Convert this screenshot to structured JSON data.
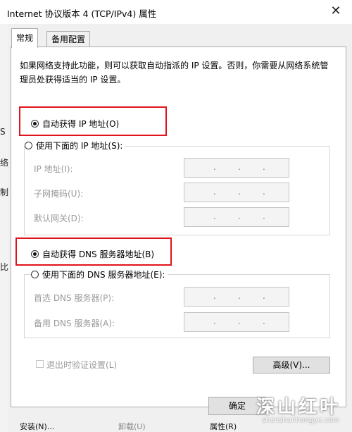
{
  "window": {
    "title": "Internet 协议版本 4 (TCP/IPv4) 属性",
    "close_glyph": "✕"
  },
  "tabs": [
    {
      "label": "常规",
      "active": true
    },
    {
      "label": "备用配置",
      "active": false
    }
  ],
  "description": "如果网络支持此功能，则可以获取自动指派的 IP 设置。否则，你需要从网络系统管理员处获得适当的 IP 设置。",
  "ip_section": {
    "auto_label": "自动获得 IP 地址(O)",
    "manual_label": "使用下面的 IP 地址(S):",
    "auto_selected": true,
    "fields": [
      {
        "label": "IP 地址(I):",
        "value": ". . ."
      },
      {
        "label": "子网掩码(U):",
        "value": ". . ."
      },
      {
        "label": "默认网关(D):",
        "value": ". . ."
      }
    ]
  },
  "dns_section": {
    "auto_label": "自动获得 DNS 服务器地址(B)",
    "manual_label": "使用下面的 DNS 服务器地址(E):",
    "auto_selected": true,
    "fields": [
      {
        "label": "首选 DNS 服务器(P):",
        "value": ". . ."
      },
      {
        "label": "备用 DNS 服务器(A):",
        "value": ". . ."
      }
    ]
  },
  "validate_on_exit_label": "退出时验证设置(L)",
  "advanced_button_label": "高级(V)...",
  "ok_button_label": "确定",
  "background_window": {
    "left_glyphs": [
      "络",
      "制",
      "比",
      "S"
    ],
    "bottom_buttons": [
      "安装(N)...",
      "卸载(U)",
      "属性(R)"
    ]
  },
  "watermark": {
    "main": "深山红叶",
    "sub": "shenshanhongye.com"
  },
  "colors": {
    "highlight_box": "#e0141b",
    "dialog_bg": "#f0f0f0",
    "panel_bg": "#ffffff"
  }
}
